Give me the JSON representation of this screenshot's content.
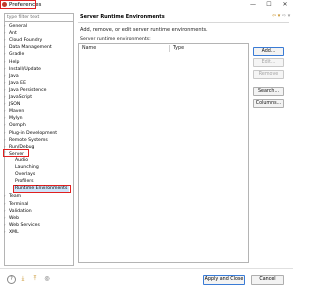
{
  "window": {
    "title": "Preferences",
    "minimize_glyph": "—",
    "restore_glyph": "☐",
    "close_glyph": "✕"
  },
  "filter": {
    "placeholder": "type filter text"
  },
  "tree": {
    "items": [
      {
        "label": "General",
        "expanded": false
      },
      {
        "label": "Ant",
        "expanded": false
      },
      {
        "label": "Cloud Foundry",
        "expanded": false
      },
      {
        "label": "Data Management",
        "expanded": false
      },
      {
        "label": "Gradle",
        "expanded": false
      },
      {
        "label": "Help",
        "expanded": false
      },
      {
        "label": "Install/Update",
        "expanded": false
      },
      {
        "label": "Java",
        "expanded": false
      },
      {
        "label": "Java EE",
        "expanded": false
      },
      {
        "label": "Java Persistence",
        "expanded": false
      },
      {
        "label": "JavaScript",
        "expanded": false
      },
      {
        "label": "JSON",
        "expanded": false
      },
      {
        "label": "Maven",
        "expanded": false
      },
      {
        "label": "Mylyn",
        "expanded": false
      },
      {
        "label": "Oomph",
        "expanded": false
      },
      {
        "label": "Plug-in Development",
        "expanded": false
      },
      {
        "label": "Remote Systems",
        "expanded": false
      },
      {
        "label": "Run/Debug",
        "expanded": false
      },
      {
        "label": "Server",
        "expanded": true
      }
    ],
    "server_children": [
      "Audio",
      "Launching",
      "Overlays",
      "Profilers",
      "Runtime Environments"
    ],
    "items_after": [
      {
        "label": "Team",
        "expanded": false
      },
      {
        "label": "Terminal",
        "expanded": false
      },
      {
        "label": "Validation",
        "expanded": false
      },
      {
        "label": "Web",
        "expanded": false
      },
      {
        "label": "Web Services",
        "expanded": false
      },
      {
        "label": "XML",
        "expanded": false
      }
    ],
    "expanded_arrow": "˅",
    "collapsed_arrow": "›"
  },
  "page": {
    "title": "Server Runtime Environments",
    "description": "Add, remove, or edit server runtime environments.",
    "list_label": "Server runtime environments:",
    "nav_back": "⇦",
    "nav_forward": "⇨",
    "nav_menu": "▾"
  },
  "table": {
    "columns": [
      "Name",
      "Type"
    ],
    "rows": []
  },
  "buttons": {
    "add": "Add...",
    "edit": "Edit...",
    "remove": "Remove",
    "search": "Search...",
    "columns": "Columns...",
    "apply_close": "Apply and Close",
    "cancel": "Cancel"
  },
  "footer_icons": {
    "help": "?",
    "import": "⤓",
    "export": "⤒",
    "settings": "◎"
  },
  "colors": {
    "highlight_box": "#e02020",
    "selection": "#cfe5fa",
    "app_icon": "#c0392b"
  }
}
